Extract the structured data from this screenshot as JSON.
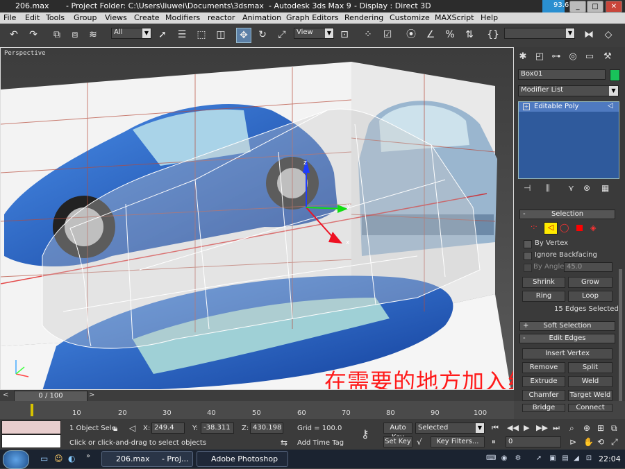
{
  "titlebar": {
    "file": "206.max",
    "project": "- Project Folder: C:\\Users\\liuwei\\Documents\\3dsmax",
    "app": "- Autodesk 3ds Max 9",
    "display": "- Display : Direct 3D",
    "fps": "93.6%"
  },
  "menu": [
    "File",
    "Edit",
    "Tools",
    "Group",
    "Views",
    "Create",
    "Modifiers",
    "reactor",
    "Animation",
    "Graph Editors",
    "Rendering",
    "Customize",
    "MAXScript",
    "Help"
  ],
  "toolbar": {
    "selection_filter": "All",
    "ref_coord": "View",
    "named_selection": ""
  },
  "viewport": {
    "label": "Perspective",
    "annotation": "在需要的地方加入线段",
    "axes": {
      "x": "x",
      "y": "y",
      "z": "z"
    }
  },
  "command_panel": {
    "object_name": "Box01",
    "object_color": "#19c25a",
    "modifier_list": "Modifier List",
    "stack_item": "Editable Poly",
    "selection_rollout": "Selection",
    "by_vertex": "By Vertex",
    "ignore_backfacing": "Ignore Backfacing",
    "by_angle": "By Angle:",
    "angle_value": "45.0",
    "shrink": "Shrink",
    "grow": "Grow",
    "ring": "Ring",
    "loop": "Loop",
    "edges_selected": "15 Edges Selected",
    "soft_selection": "Soft Selection",
    "edit_edges": "Edit Edges",
    "insert_vertex": "Insert Vertex",
    "remove": "Remove",
    "split": "Split",
    "extrude": "Extrude",
    "weld": "Weld",
    "chamfer": "Chamfer",
    "target_weld": "Target Weld",
    "bridge": "Bridge",
    "connect": "Connect"
  },
  "timeline": {
    "frame": "0 / 100",
    "ticks": [
      "10",
      "20",
      "30",
      "40",
      "50",
      "60",
      "70",
      "80",
      "90",
      "100"
    ]
  },
  "status": {
    "selection": "1 Object Sele",
    "x_label": "X:",
    "x": "249.4",
    "y_label": "Y:",
    "y": "-38.311",
    "z_label": "Z:",
    "z": "430.198",
    "grid": "Grid = 100.0",
    "prompt": "Click or click-and-drag to select objects",
    "add_time_tag": "Add Time Tag",
    "auto_key": "Auto Key",
    "set_key": "Set Key",
    "selected": "Selected",
    "key_filters": "Key Filters...",
    "current_frame": "0"
  },
  "taskbar": {
    "task1": "206.max",
    "task1b": "- Proj...",
    "task2": "Adobe Photoshop",
    "clock": "22:04"
  }
}
